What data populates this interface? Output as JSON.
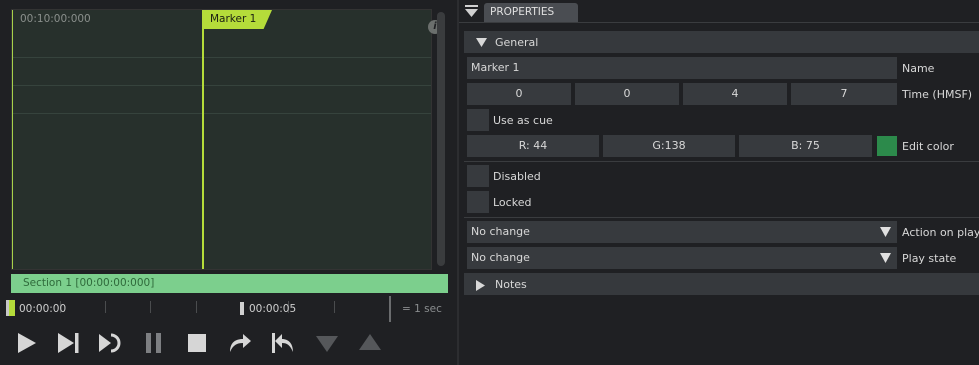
{
  "timeline": {
    "start_time": "00:10:00:000",
    "marker_label": "Marker 1",
    "section_label": "Section 1 [00:00:00:000]",
    "ruler_time_start": "00:00:00",
    "ruler_time_mid": "00:00:05",
    "ruler_scale": "= 1 sec",
    "info_icon_glyph": "i"
  },
  "transport": {
    "buttons": [
      "play-icon",
      "next-icon",
      "loop-icon",
      "pause-icon",
      "stop-icon",
      "redo-icon",
      "undo-icon",
      "arrow-down-icon",
      "arrow-up-icon"
    ]
  },
  "properties": {
    "tab_label": "PROPERTIES",
    "general": {
      "header": "General",
      "name_value": "Marker 1",
      "name_label": "Name",
      "time_values": [
        "0",
        "0",
        "4",
        "7"
      ],
      "time_label": "Time (HMSF)",
      "use_as_cue_label": "Use as cue",
      "color_r": "R: 44",
      "color_g": "G:138",
      "color_b": "B: 75",
      "color_swatch": "#2c8a4b",
      "edit_color_label": "Edit color",
      "disabled_label": "Disabled",
      "locked_label": "Locked",
      "action_value": "No change",
      "action_label": "Action on playh",
      "play_state_value": "No change",
      "play_state_label": "Play state"
    },
    "notes_header": "Notes"
  },
  "colors": {
    "marker": "#b5dc3a",
    "section": "#7ccf8d",
    "accent_bg": "#27302c"
  }
}
